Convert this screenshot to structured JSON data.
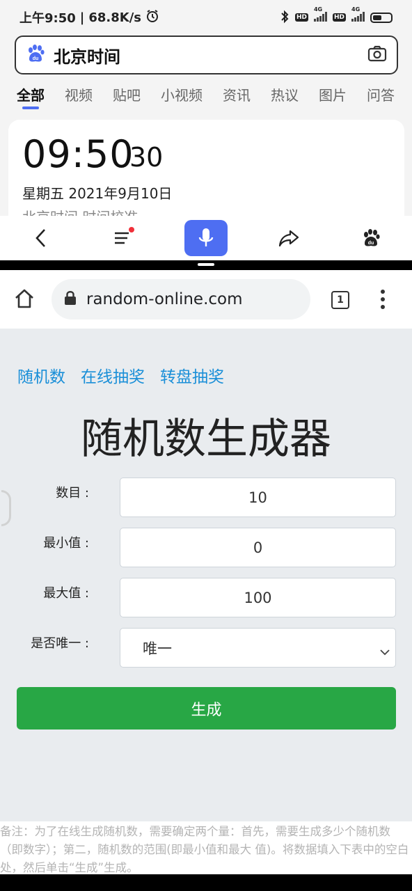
{
  "status": {
    "time": "上午9:50",
    "speed": "68.8K/s",
    "network": "4G",
    "hd": "HD"
  },
  "baidu": {
    "query": "北京时间",
    "tabs": [
      "全部",
      "视频",
      "贴吧",
      "小视频",
      "资讯",
      "热议",
      "图片",
      "问答"
    ],
    "active_tab": "全部",
    "clock": {
      "time": "09:50",
      "seconds": "30",
      "date": "星期五  2021年9月10日",
      "sub": "北京时间  时间校准"
    }
  },
  "chrome": {
    "url": "random-online.com",
    "tab_count": "1"
  },
  "page": {
    "nav": [
      "随机数",
      "在线抽奖",
      "转盘抽奖"
    ],
    "title": "随机数生成器",
    "fields": {
      "count": {
        "label": "数目 :",
        "value": "10"
      },
      "min": {
        "label": "最小值 :",
        "value": "0"
      },
      "max": {
        "label": "最大值 :",
        "value": "100"
      },
      "unique": {
        "label": "是否唯一 :",
        "value": "唯一"
      }
    },
    "generate_label": "生成",
    "note": "备注：为了在线生成随机数，需要确定两个量：首先，需要生成多少个随机数（即数字）；第二，随机数的范围(即最小值和最大 值)。将数据填入下表中的空白处，然后单击“生成”生成。"
  },
  "colors": {
    "baidu_blue": "#4e6ef2",
    "link_blue": "#1a8fd8",
    "generate_green": "#28a745",
    "notification_red": "#f0303a"
  }
}
